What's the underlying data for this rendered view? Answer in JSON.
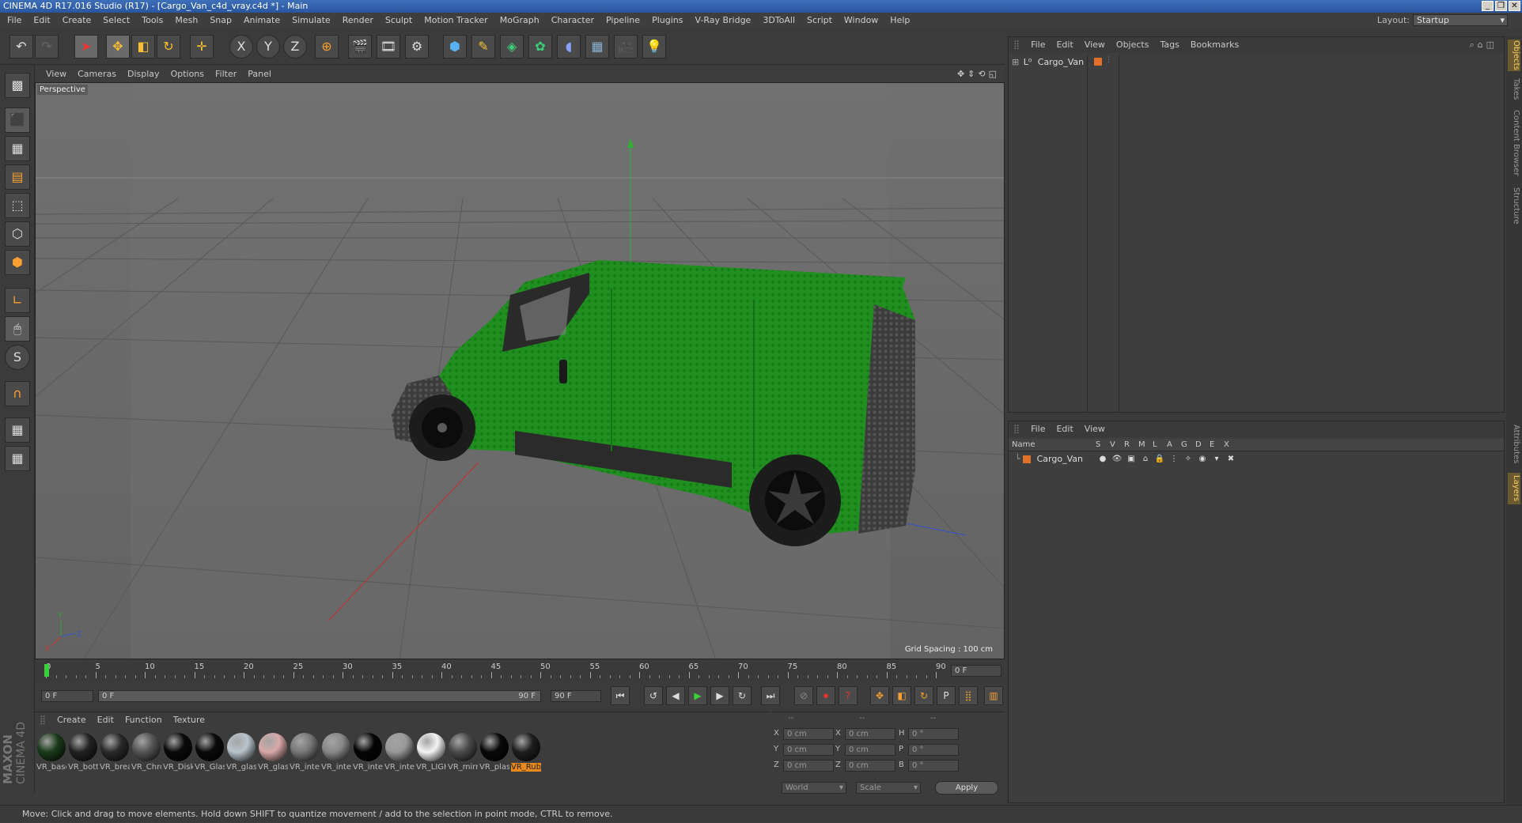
{
  "window": {
    "title": "CINEMA 4D R17.016 Studio (R17) - [Cargo_Van_c4d_vray.c4d *] - Main"
  },
  "menubar": {
    "items": [
      "File",
      "Edit",
      "Create",
      "Select",
      "Tools",
      "Mesh",
      "Snap",
      "Animate",
      "Simulate",
      "Render",
      "Sculpt",
      "Motion Tracker",
      "MoGraph",
      "Character",
      "Pipeline",
      "Plugins",
      "V-Ray Bridge",
      "3DToAll",
      "Script",
      "Window",
      "Help"
    ],
    "layout_label": "Layout:",
    "layout_value": "Startup"
  },
  "toolbar": {
    "axis_x": "X",
    "axis_y": "Y",
    "axis_z": "Z"
  },
  "viewport": {
    "menu": [
      "View",
      "Cameras",
      "Display",
      "Options",
      "Filter",
      "Panel"
    ],
    "camera_label": "Perspective",
    "grid_spacing": "Grid Spacing : 100 cm"
  },
  "timeline": {
    "ticks": [
      "0",
      "5",
      "10",
      "15",
      "20",
      "25",
      "30",
      "35",
      "40",
      "45",
      "50",
      "55",
      "60",
      "65",
      "70",
      "75",
      "80",
      "85",
      "90"
    ],
    "current_frame": "0 F"
  },
  "transport": {
    "start_field": "0 F",
    "range_start": "0 F",
    "range_end": "90 F",
    "end_field": "90 F"
  },
  "material_manager": {
    "menu": [
      "Create",
      "Edit",
      "Function",
      "Texture"
    ],
    "materials": [
      {
        "label": "VR_base",
        "color": "#1a3a1a"
      },
      {
        "label": "VR_botto",
        "color": "#222222"
      },
      {
        "label": "VR_brea",
        "color": "#2a2a2a"
      },
      {
        "label": "VR_Chro",
        "color": "#555555"
      },
      {
        "label": "VR_Disk",
        "color": "#0a0a0a"
      },
      {
        "label": "VR_Glass",
        "color": "#0a0a0a"
      },
      {
        "label": "VR_glass",
        "color": "#b8c4cc"
      },
      {
        "label": "VR_glass",
        "color": "#d8a8a8"
      },
      {
        "label": "VR_inter",
        "color": "#777777"
      },
      {
        "label": "VR_inter",
        "color": "#888888"
      },
      {
        "label": "VR_inter",
        "color": "#050505"
      },
      {
        "label": "VR_inter",
        "color": "#999999"
      },
      {
        "label": "VR_LIGH",
        "color": "#f4f4f4"
      },
      {
        "label": "VR_mirro",
        "color": "#4a4a4a"
      },
      {
        "label": "VR_plast",
        "color": "#080808"
      },
      {
        "label": "VR_Rubb",
        "color": "#1e1e1e"
      }
    ],
    "selected_index": 15
  },
  "coordinates": {
    "header": [
      "--",
      "--",
      "--"
    ],
    "rows": [
      {
        "a": "X",
        "av": "0 cm",
        "b": "X",
        "bv": "0 cm",
        "c": "H",
        "cv": "0 °"
      },
      {
        "a": "Y",
        "av": "0 cm",
        "b": "Y",
        "bv": "0 cm",
        "c": "P",
        "cv": "0 °"
      },
      {
        "a": "Z",
        "av": "0 cm",
        "b": "Z",
        "bv": "0 cm",
        "c": "B",
        "cv": "0 °"
      }
    ],
    "mode_world": "World",
    "mode_scale": "Scale",
    "apply": "Apply"
  },
  "object_manager": {
    "menu": [
      "File",
      "Edit",
      "View",
      "Objects",
      "Tags",
      "Bookmarks"
    ],
    "object_name": "Cargo_Van"
  },
  "layer_manager": {
    "menu": [
      "File",
      "Edit",
      "View"
    ],
    "columns": [
      "Name",
      "S",
      "V",
      "R",
      "M",
      "L",
      "A",
      "G",
      "D",
      "E",
      "X"
    ],
    "layer_name": "Cargo_Van"
  },
  "right_tabs": [
    "Objects",
    "Takes",
    "Content Browser",
    "Structure",
    "Attributes",
    "Layers"
  ],
  "statusbar": {
    "text": "Move: Click and drag to move elements. Hold down SHIFT to quantize movement / add to the selection in point mode, CTRL to remove."
  },
  "brand": {
    "maxon": "MAXON",
    "cinema": "CINEMA 4D"
  },
  "colors": {
    "van_green": "#1f8f1f",
    "selection": "#e88a1a",
    "accent_blue": "#3e6fb8"
  }
}
